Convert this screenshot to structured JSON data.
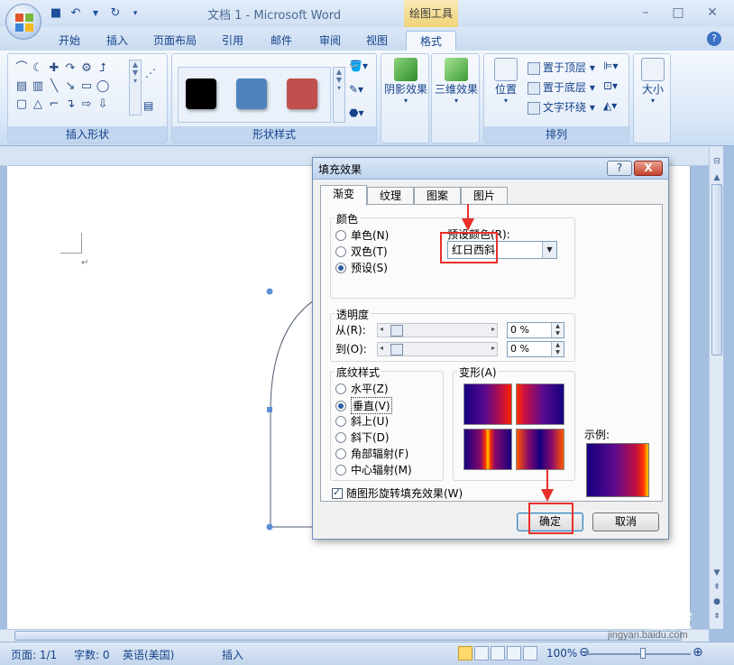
{
  "window": {
    "app_title": "文档 1 - Microsoft Word",
    "context_tab_title": "绘图工具"
  },
  "tabs": [
    {
      "label": "开始"
    },
    {
      "label": "插入"
    },
    {
      "label": "页面布局"
    },
    {
      "label": "引用"
    },
    {
      "label": "邮件"
    },
    {
      "label": "审阅"
    },
    {
      "label": "视图"
    },
    {
      "label": "格式"
    }
  ],
  "ribbon": {
    "insert_shapes_label": "插入形状",
    "shape_styles_label": "形状样式",
    "shadow_effect": "阴影效果",
    "three_d_effect": "三维效果",
    "position": "位置",
    "bring_to_front": "置于顶层",
    "send_to_back": "置于底层",
    "text_wrap": "文字环绕",
    "arrange_label": "排列",
    "size": "大小",
    "style_swatches": [
      "#000000",
      "#4f81bd",
      "#c0504d"
    ]
  },
  "dialog": {
    "title": "填充效果",
    "help_button": "?",
    "close_button": "X",
    "tabs": [
      {
        "label": "渐变"
      },
      {
        "label": "纹理"
      },
      {
        "label": "图案"
      },
      {
        "label": "图片"
      }
    ],
    "color_section": {
      "label": "颜色",
      "options": [
        "单色(N)",
        "双色(T)",
        "预设(S)"
      ],
      "selected": "预设(S)",
      "preset_label": "预设颜色(R):",
      "preset_value": "红日西斜"
    },
    "transparency": {
      "label": "透明度",
      "from_label": "从(R):",
      "from_value": "0 %",
      "to_label": "到(O):",
      "to_value": "0 %"
    },
    "shading_styles": {
      "label": "底纹样式",
      "options": [
        "水平(Z)",
        "垂直(V)",
        "斜上(U)",
        "斜下(D)",
        "角部辐射(F)",
        "中心辐射(M)"
      ],
      "selected": "垂直(V)"
    },
    "variants_label": "变形(A)",
    "sample_label": "示例:",
    "rotate_checkbox": "随图形旋转填充效果(W)",
    "ok_button": "确定",
    "cancel_button": "取消"
  },
  "statusbar": {
    "page": "页面: 1/1",
    "words": "字数: 0",
    "language": "英语(美国)",
    "insert_mode": "插入",
    "zoom": "100%"
  },
  "watermark": {
    "text": "Baidu经验",
    "url": "jingyan.baidu.com"
  }
}
